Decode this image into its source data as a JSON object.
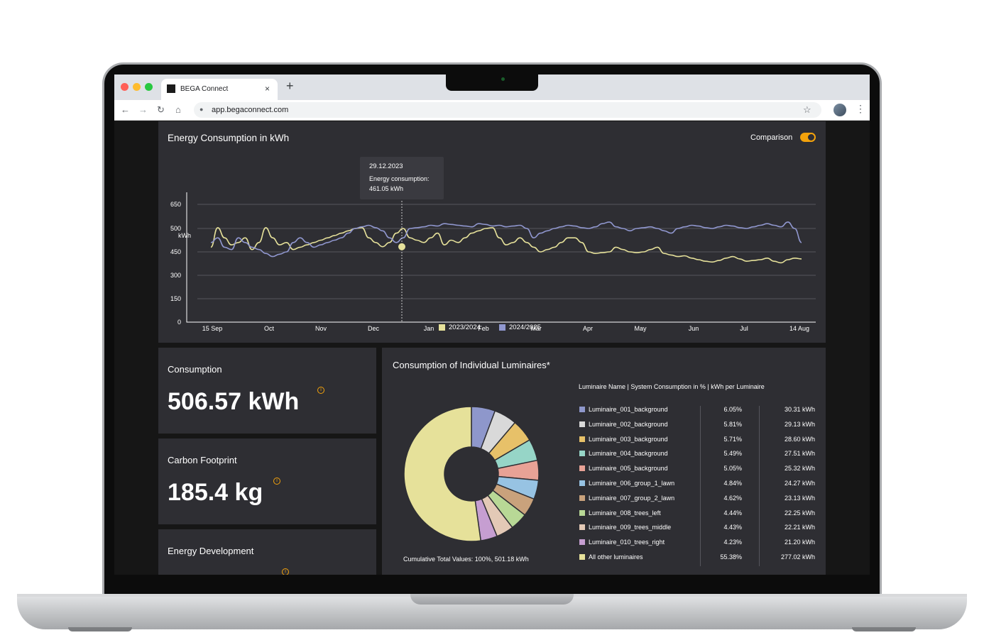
{
  "browser": {
    "tab_title": "BEGA Connect",
    "tab_close": "×",
    "new_tab": "+",
    "url": "app.begaconnect.com",
    "icons": {
      "back": "←",
      "forward": "→",
      "reload": "↻",
      "home": "⌂",
      "lock": "🔒",
      "star": "☆",
      "menu": "⋮"
    }
  },
  "energy_chart": {
    "title": "Energy Consumption in kWh",
    "comparison_label": "Comparison",
    "comparison_on": true,
    "tooltip": {
      "date": "29.12.2023",
      "label": "Energy consumption:",
      "value": "461.05 kWh"
    },
    "legend": [
      {
        "label": "2023/2024",
        "color": "#e6e19a"
      },
      {
        "label": "2024/2025",
        "color": "#9097cf"
      }
    ]
  },
  "chart_data": {
    "type": "line",
    "title": "Energy Consumption in kWh",
    "ylabel": "kWh",
    "y_ticks": [
      "0",
      "150",
      "300",
      "450",
      "500",
      "650"
    ],
    "x_ticks": [
      "15 Sep",
      "Oct",
      "Nov",
      "Dec",
      "Jan",
      "Feb",
      "Mar",
      "Apr",
      "May",
      "Jun",
      "Jul",
      "14 Aug"
    ],
    "grid": true,
    "legend_placement": "bottom",
    "series": [
      {
        "name": "2023/2024",
        "color": "#e6e19a",
        "values": [
          460,
          505,
          480,
          465,
          470,
          480,
          455,
          470,
          505,
          480,
          465,
          470,
          455,
          460,
          465,
          470,
          475,
          480,
          485,
          490,
          495,
          500,
          505,
          480,
          470,
          461,
          470,
          490,
          500,
          480,
          475,
          470,
          480,
          490,
          465,
          475,
          470,
          480,
          490,
          495,
          500,
          505,
          480,
          465,
          470,
          480,
          470,
          460,
          450,
          455,
          460,
          470,
          480,
          480,
          470,
          450,
          440,
          445,
          450,
          460,
          455,
          450,
          445,
          450,
          455,
          460,
          440,
          430,
          420,
          425,
          410,
          400,
          390,
          385,
          395,
          410,
          420,
          405,
          390,
          395,
          400,
          410,
          390,
          380,
          400,
          410,
          405
        ]
      },
      {
        "name": "2024/2025",
        "color": "#9097cf",
        "values": [
          470,
          480,
          460,
          455,
          480,
          470,
          460,
          455,
          440,
          420,
          435,
          450,
          470,
          480,
          470,
          460,
          465,
          470,
          475,
          480,
          490,
          500,
          510,
          520,
          505,
          495,
          480,
          470,
          480,
          500,
          505,
          510,
          520,
          515,
          530,
          525,
          520,
          515,
          510,
          530,
          525,
          515,
          520,
          510,
          515,
          520,
          500,
          480,
          490,
          495,
          500,
          510,
          520,
          515,
          505,
          500,
          510,
          530,
          540,
          510,
          500,
          495,
          500,
          505,
          510,
          500,
          495,
          490,
          500,
          510,
          520,
          515,
          505,
          500,
          510,
          520,
          515,
          505,
          500,
          510,
          520,
          530,
          520,
          510,
          540,
          500,
          470
        ]
      }
    ]
  },
  "kpis": [
    {
      "title": "Consumption",
      "value": "506.57 kWh",
      "info": "i"
    },
    {
      "title": "Carbon Footprint",
      "value": "185.4 kg",
      "info": "i"
    },
    {
      "title": "Energy Development",
      "value": "",
      "info": "i"
    }
  ],
  "luminaires": {
    "title": "Consumption of Individual Luminaires*",
    "header": "Luminaire Name | System Consumption in % | kWh per Luminaire",
    "cumulative": "Cumulative Total Values: 100%, 501.18 kWh",
    "rows": [
      {
        "name": "Luminaire_001_background",
        "pct": "6.05%",
        "kwh": "30.31 kWh",
        "color": "#8e97cb",
        "share": 6.05
      },
      {
        "name": "Luminaire_002_background",
        "pct": "5.81%",
        "kwh": "29.13 kWh",
        "color": "#d9d9d9",
        "share": 5.81
      },
      {
        "name": "Luminaire_003_background",
        "pct": "5.71%",
        "kwh": "28.60 kWh",
        "color": "#e7c169",
        "share": 5.71
      },
      {
        "name": "Luminaire_004_background",
        "pct": "5.49%",
        "kwh": "27.51 kWh",
        "color": "#96d5c7",
        "share": 5.49
      },
      {
        "name": "Luminaire_005_background",
        "pct": "5.05%",
        "kwh": "25.32 kWh",
        "color": "#e8a296",
        "share": 5.05
      },
      {
        "name": "Luminaire_006_group_1_lawn",
        "pct": "4.84%",
        "kwh": "24.27 kWh",
        "color": "#97c3e3",
        "share": 4.84
      },
      {
        "name": "Luminaire_007_group_2_lawn",
        "pct": "4.62%",
        "kwh": "23.13 kWh",
        "color": "#c9a27c",
        "share": 4.62
      },
      {
        "name": "Luminaire_008_trees_left",
        "pct": "4.44%",
        "kwh": "22.25 kWh",
        "color": "#b8d896",
        "share": 4.44
      },
      {
        "name": "Luminaire_009_trees_middle",
        "pct": "4.43%",
        "kwh": "22.21 kWh",
        "color": "#e3c9b6",
        "share": 4.43
      },
      {
        "name": "Luminaire_010_trees_right",
        "pct": "4.23%",
        "kwh": "21.20 kWh",
        "color": "#c69ed1",
        "share": 4.23
      },
      {
        "name": "All other luminaires",
        "pct": "55.38%",
        "kwh": "277.02 kWh",
        "color": "#e6e19a",
        "share": 55.38
      }
    ]
  },
  "colors": {
    "accent": "#f3a20c",
    "card": "#2e2e33",
    "background": "#161616"
  }
}
